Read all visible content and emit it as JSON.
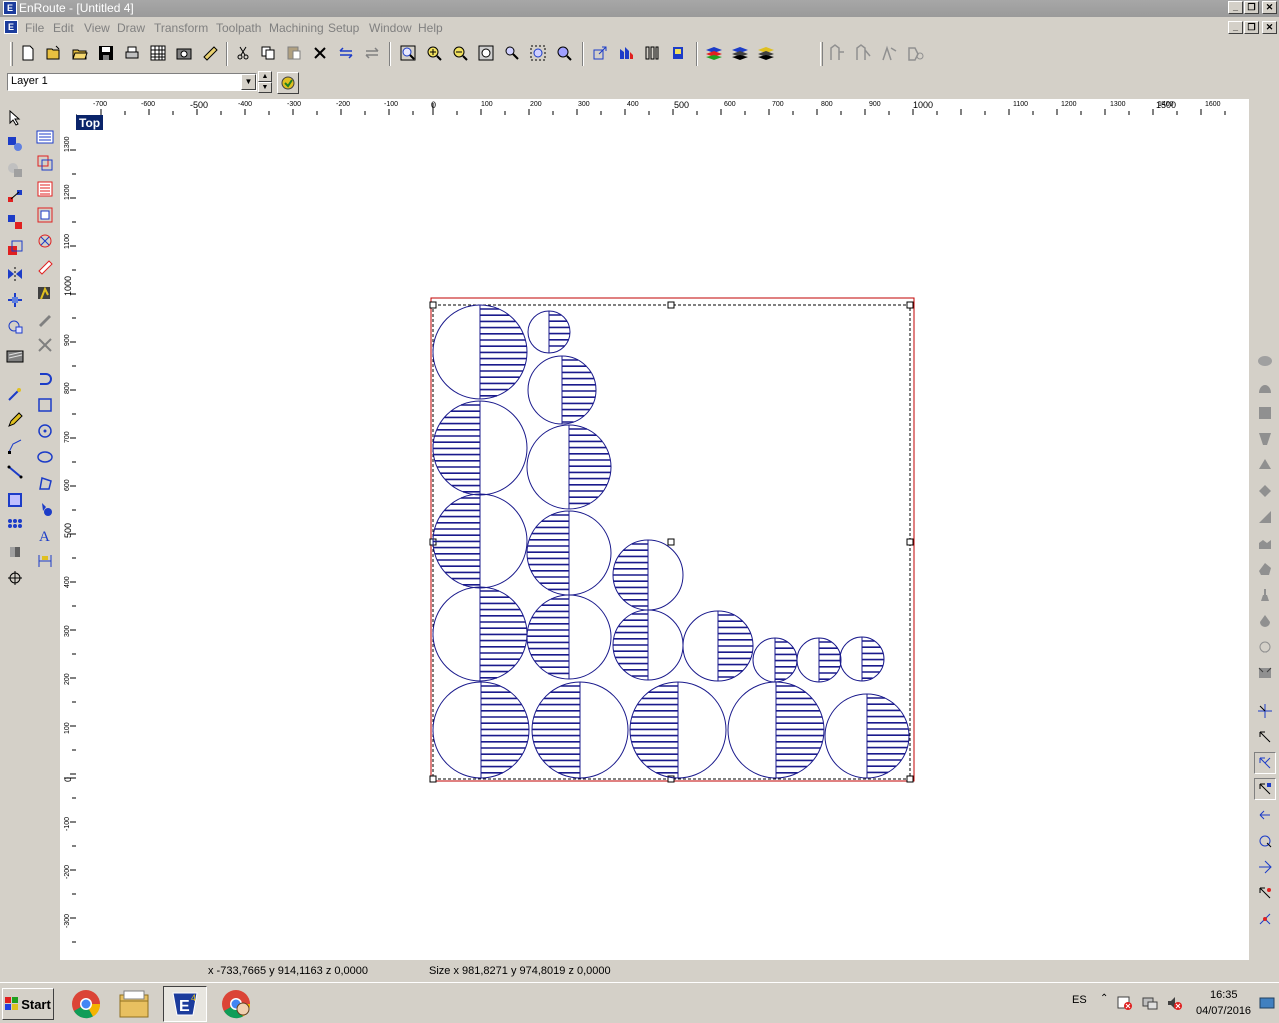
{
  "window": {
    "title": "EnRoute - [Untitled 4]",
    "app_icon_letter": "E",
    "controls": [
      "_",
      "❐",
      "✕"
    ]
  },
  "menu": [
    "File",
    "Edit",
    "View",
    "Draw",
    "Transform",
    "Toolpath",
    "Machining",
    "Setup",
    "Window",
    "Help"
  ],
  "toolbar": {
    "file_buttons": [
      "new-icon",
      "open-icon",
      "open-folder-icon",
      "save-icon",
      "print-icon",
      "grid-icon",
      "camera-icon",
      "ruler-icon"
    ],
    "edit_buttons": [
      "cut-icon",
      "copy-icon",
      "paste-icon",
      "delete-icon",
      "undo-icon",
      "redo-icon"
    ],
    "zoom_buttons": [
      "zoom-select-icon",
      "zoom-in-icon",
      "zoom-out-icon",
      "zoom-fit-icon",
      "zoom-window-icon",
      "zoom-all-icon",
      "zoom-previous-icon"
    ],
    "view_buttons": [
      "view-rotate-icon",
      "view-front-icon",
      "view-side-icon",
      "view-render-icon"
    ],
    "layer_buttons": [
      "layers-icon",
      "layers-stack-icon",
      "layers-color-icon"
    ],
    "toolpath_buttons": [
      "toolpath-a-icon",
      "toolpath-b-icon",
      "toolpath-c-icon",
      "toolpath-d-icon"
    ]
  },
  "layer": {
    "current": "Layer 1"
  },
  "view": {
    "tag": "Top"
  },
  "hruler": [
    "-700",
    "-600",
    "-500",
    "-400",
    "-300",
    "-200",
    "-100",
    "0",
    "100",
    "200",
    "300",
    "400",
    "500",
    "600",
    "700",
    "800",
    "900",
    "1000",
    "1100",
    "1200",
    "1300",
    "1400",
    "1500",
    "1600"
  ],
  "vruler": [
    "1300",
    "1200",
    "1100",
    "1000",
    "900",
    "800",
    "700",
    "600",
    "500",
    "400",
    "300",
    "200",
    "100",
    "0",
    "-100",
    "-200",
    "-300"
  ],
  "status": {
    "coords": "x -733,7665 y 914,1163 z 0,0000",
    "size": "Size x 981,8271 y 974,8019 z 0,0000"
  },
  "taskbar": {
    "start": "Start",
    "apps": [
      "chrome-icon",
      "file-explorer-icon",
      "enroute-icon",
      "chrome-user-icon"
    ],
    "lang": "ES",
    "time": "16:35",
    "date": "04/07/2016"
  },
  "colors": {
    "shape_stroke": "#1a1a8c",
    "selection_box": "#c00000",
    "title_bar": "#a0a0a0",
    "view_tag_bg": "#0a246a"
  }
}
